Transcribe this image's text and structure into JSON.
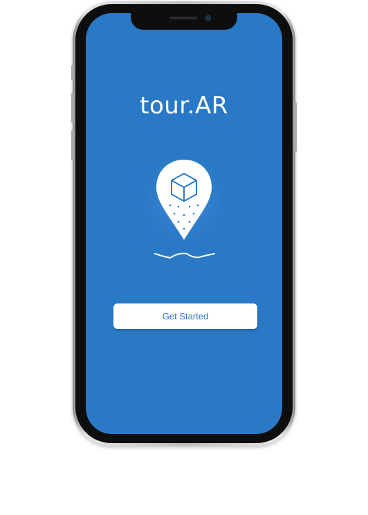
{
  "app": {
    "title": "tour.AR"
  },
  "splash": {
    "logo_icon": "map-pin-cube-icon",
    "wave_icon": "wave-line-icon",
    "get_started_label": "Get Started"
  },
  "colors": {
    "screen_background": "#2a79c6",
    "button_background": "#ffffff",
    "button_text": "#2a79c6",
    "title_text": "#ffffff"
  }
}
